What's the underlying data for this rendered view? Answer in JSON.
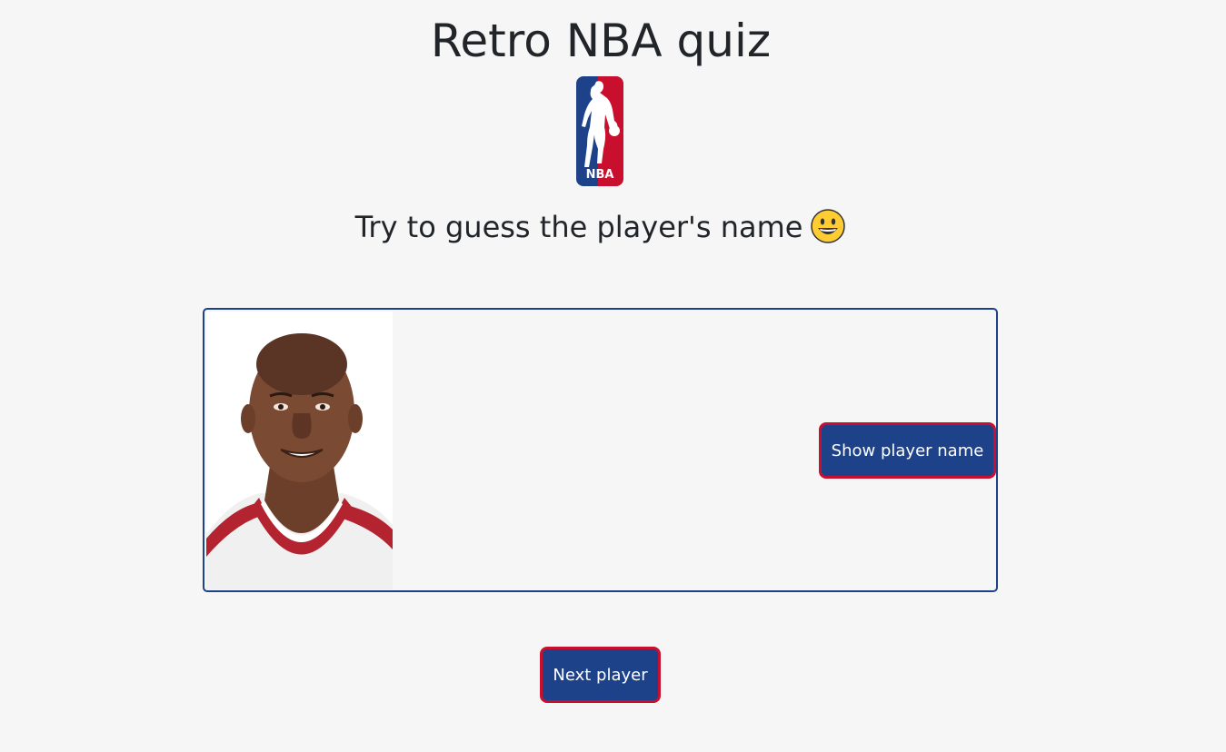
{
  "page": {
    "title": "Retro NBA quiz",
    "subtitle": "Try to guess the player's name",
    "subtitle_emoji_icon": "grinning-face-emoji-icon",
    "logo_icon": "nba-logo-icon",
    "logo_text": "NBA"
  },
  "card": {
    "player_image_icon": "player-headshot-image",
    "show_name_label": "Show player name"
  },
  "actions": {
    "next_label": "Next player"
  },
  "colors": {
    "background": "#f6f6f6",
    "brand_blue": "#1d428a",
    "brand_red": "#c8102e",
    "text": "#212529"
  }
}
